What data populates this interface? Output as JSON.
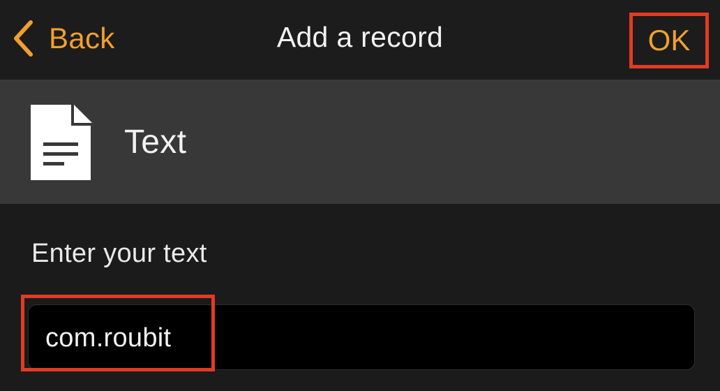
{
  "nav": {
    "back_label": "Back",
    "title": "Add a record",
    "ok_label": "OK"
  },
  "record_type": {
    "icon": "document-text-icon",
    "label": "Text"
  },
  "form": {
    "field_label": "Enter your text",
    "input_value": "com.roubit"
  },
  "colors": {
    "accent": "#f0a030",
    "highlight": "#e23b24",
    "nav_bg": "#1c1c1c",
    "section_bg": "#383838",
    "input_bg": "#000000"
  }
}
